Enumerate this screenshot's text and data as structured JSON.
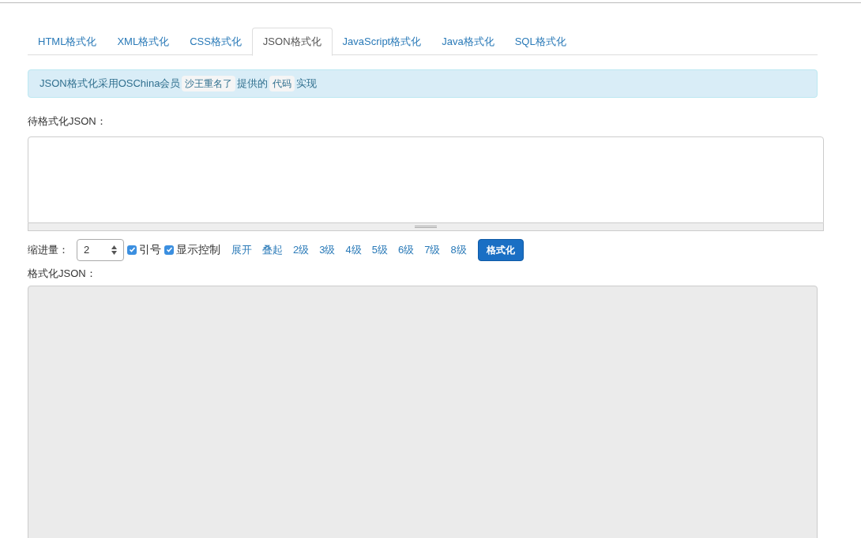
{
  "tabs": [
    {
      "label": "HTML格式化",
      "selected": false
    },
    {
      "label": "XML格式化",
      "selected": false
    },
    {
      "label": "CSS格式化",
      "selected": false
    },
    {
      "label": "JSON格式化",
      "selected": true
    },
    {
      "label": "JavaScript格式化",
      "selected": false
    },
    {
      "label": "Java格式化",
      "selected": false
    },
    {
      "label": "SQL格式化",
      "selected": false
    }
  ],
  "notice": [
    {
      "kind": "text",
      "text": "JSON格式化采用OSChina会员"
    },
    {
      "kind": "code",
      "text": "沙王重名了"
    },
    {
      "kind": "text",
      "text": "提供的"
    },
    {
      "kind": "code",
      "text": "代码"
    },
    {
      "kind": "text",
      "text": "实现"
    }
  ],
  "input_label": "待格式化JSON：",
  "indent": {
    "label": "缩进量：",
    "value": "2"
  },
  "checkboxes": [
    {
      "label": "引号",
      "checked": true
    },
    {
      "label": "显示控制",
      "checked": true
    }
  ],
  "links": [
    "展开",
    "叠起",
    "2级",
    "3级",
    "4级",
    "5级",
    "6级",
    "7级",
    "8级"
  ],
  "format_button": "格式化",
  "output_label": "格式化JSON："
}
